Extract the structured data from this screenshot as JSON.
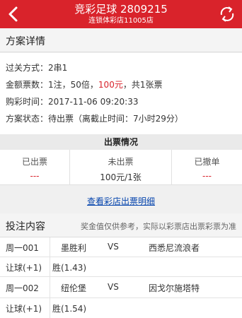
{
  "header": {
    "title": "竞彩足球  2809215",
    "subtitle": "连锁体彩店11005店"
  },
  "plan": {
    "section_title": "方案详情",
    "pass_label": "过关方式：",
    "pass_value": "2串1",
    "amount_label": "金额票数：",
    "amount_prefix": "1注，50倍，",
    "amount_money": "100元",
    "amount_suffix": "，共1张票",
    "time_label": "购彩时间：",
    "time_value": "2017-11-06 09:20:33",
    "status_label": "方案状态：",
    "status_value": "待出票（离截止时间：7小时29分）"
  },
  "issue": {
    "title": "出票情况",
    "issued_label": "已出票",
    "issued_value": "---",
    "pending_label": "未出票",
    "pending_value": "100元/1张",
    "cancelled_label": "已撤单",
    "cancelled_value": "---",
    "link": "查看彩店出票明细"
  },
  "bets": {
    "section_title": "投注内容",
    "note": "奖金值仅供参考，实际以彩票店出票彩票为准",
    "matches": [
      {
        "id": "周一001",
        "home": "墨胜利",
        "vs": "VS",
        "away": "西悉尼流浪者",
        "handicap": "让球(+1)",
        "pick": "胜(1.43)"
      },
      {
        "id": "周一002",
        "home": "纽伦堡",
        "vs": "VS",
        "away": "因戈尔施塔特",
        "handicap": "让球(+1)",
        "pick": "胜(1.54)"
      }
    ]
  },
  "colors": {
    "brand": "#d9232b",
    "link": "#0645ad"
  }
}
